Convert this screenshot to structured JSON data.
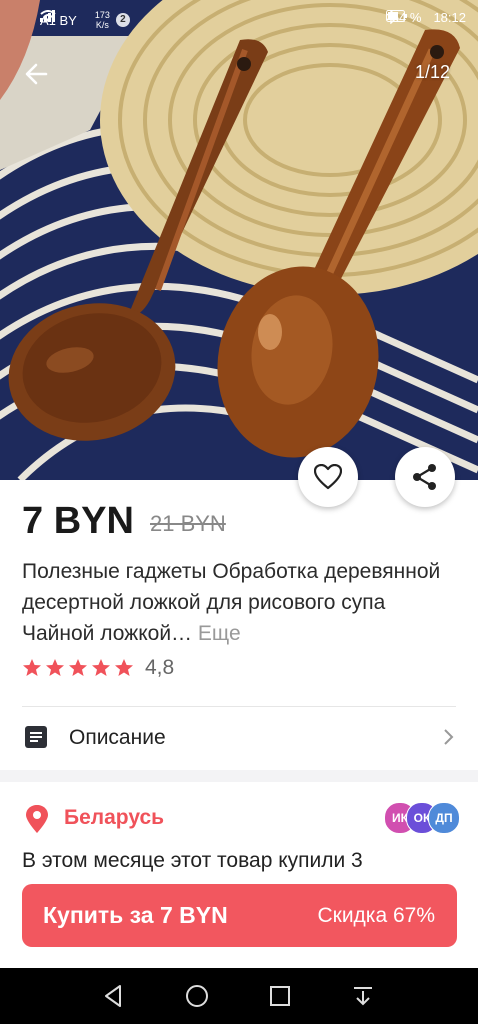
{
  "status_bar": {
    "carrier": "A1 BY",
    "net_speed_value": "173",
    "net_speed_unit": "K/s",
    "notifications": "2",
    "battery": "54 %",
    "time": "18:12"
  },
  "gallery": {
    "counter": "1/12"
  },
  "product": {
    "price": "7 BYN",
    "old_price": "21 BYN",
    "title": "Полезные гаджеты Обработка деревянной десертной ложкой для рисового супа Чайной ложкой…",
    "more": "Еще",
    "rating": "4,8",
    "stars": 5
  },
  "description": {
    "label": "Описание"
  },
  "location": {
    "country": "Беларусь"
  },
  "buyers": {
    "avatars": [
      {
        "initials": "ИК",
        "color": "#d14fb0"
      },
      {
        "initials": "ОК",
        "color": "#6b4fd9"
      },
      {
        "initials": "ДП",
        "color": "#4f8ad9"
      }
    ],
    "text": "В этом месяце этот товар купили 3"
  },
  "buy": {
    "label": "Купить за 7 BYN",
    "discount": "Скидка 67%"
  },
  "colors": {
    "accent": "#f2575f",
    "location": "#f0525a",
    "star": "#f0525a"
  }
}
